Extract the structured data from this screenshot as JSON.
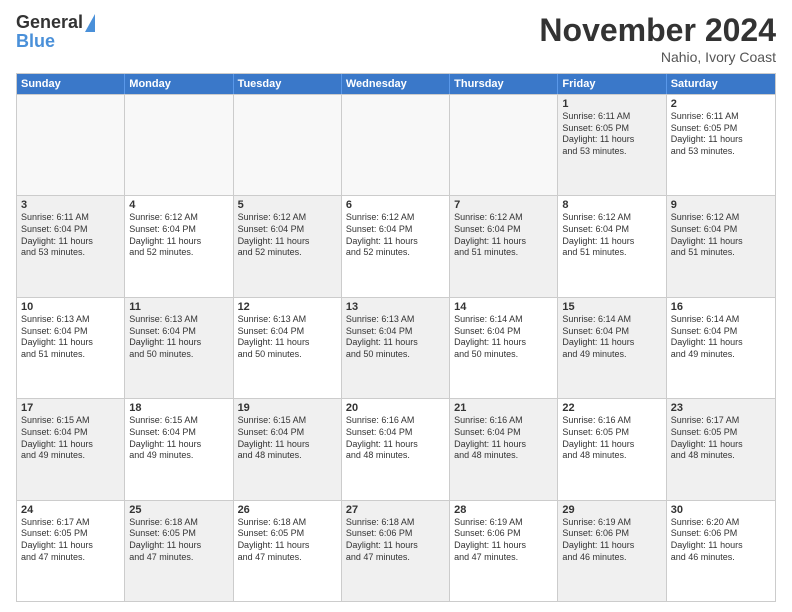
{
  "logo": {
    "general": "General",
    "blue": "Blue"
  },
  "title": "November 2024",
  "location": "Nahio, Ivory Coast",
  "days": [
    "Sunday",
    "Monday",
    "Tuesday",
    "Wednesday",
    "Thursday",
    "Friday",
    "Saturday"
  ],
  "rows": [
    [
      {
        "num": "",
        "lines": []
      },
      {
        "num": "",
        "lines": []
      },
      {
        "num": "",
        "lines": []
      },
      {
        "num": "",
        "lines": []
      },
      {
        "num": "",
        "lines": []
      },
      {
        "num": "1",
        "lines": [
          "Sunrise: 6:11 AM",
          "Sunset: 6:05 PM",
          "Daylight: 11 hours",
          "and 53 minutes."
        ]
      },
      {
        "num": "2",
        "lines": [
          "Sunrise: 6:11 AM",
          "Sunset: 6:05 PM",
          "Daylight: 11 hours",
          "and 53 minutes."
        ]
      }
    ],
    [
      {
        "num": "3",
        "lines": [
          "Sunrise: 6:11 AM",
          "Sunset: 6:04 PM",
          "Daylight: 11 hours",
          "and 53 minutes."
        ]
      },
      {
        "num": "4",
        "lines": [
          "Sunrise: 6:12 AM",
          "Sunset: 6:04 PM",
          "Daylight: 11 hours",
          "and 52 minutes."
        ]
      },
      {
        "num": "5",
        "lines": [
          "Sunrise: 6:12 AM",
          "Sunset: 6:04 PM",
          "Daylight: 11 hours",
          "and 52 minutes."
        ]
      },
      {
        "num": "6",
        "lines": [
          "Sunrise: 6:12 AM",
          "Sunset: 6:04 PM",
          "Daylight: 11 hours",
          "and 52 minutes."
        ]
      },
      {
        "num": "7",
        "lines": [
          "Sunrise: 6:12 AM",
          "Sunset: 6:04 PM",
          "Daylight: 11 hours",
          "and 51 minutes."
        ]
      },
      {
        "num": "8",
        "lines": [
          "Sunrise: 6:12 AM",
          "Sunset: 6:04 PM",
          "Daylight: 11 hours",
          "and 51 minutes."
        ]
      },
      {
        "num": "9",
        "lines": [
          "Sunrise: 6:12 AM",
          "Sunset: 6:04 PM",
          "Daylight: 11 hours",
          "and 51 minutes."
        ]
      }
    ],
    [
      {
        "num": "10",
        "lines": [
          "Sunrise: 6:13 AM",
          "Sunset: 6:04 PM",
          "Daylight: 11 hours",
          "and 51 minutes."
        ]
      },
      {
        "num": "11",
        "lines": [
          "Sunrise: 6:13 AM",
          "Sunset: 6:04 PM",
          "Daylight: 11 hours",
          "and 50 minutes."
        ]
      },
      {
        "num": "12",
        "lines": [
          "Sunrise: 6:13 AM",
          "Sunset: 6:04 PM",
          "Daylight: 11 hours",
          "and 50 minutes."
        ]
      },
      {
        "num": "13",
        "lines": [
          "Sunrise: 6:13 AM",
          "Sunset: 6:04 PM",
          "Daylight: 11 hours",
          "and 50 minutes."
        ]
      },
      {
        "num": "14",
        "lines": [
          "Sunrise: 6:14 AM",
          "Sunset: 6:04 PM",
          "Daylight: 11 hours",
          "and 50 minutes."
        ]
      },
      {
        "num": "15",
        "lines": [
          "Sunrise: 6:14 AM",
          "Sunset: 6:04 PM",
          "Daylight: 11 hours",
          "and 49 minutes."
        ]
      },
      {
        "num": "16",
        "lines": [
          "Sunrise: 6:14 AM",
          "Sunset: 6:04 PM",
          "Daylight: 11 hours",
          "and 49 minutes."
        ]
      }
    ],
    [
      {
        "num": "17",
        "lines": [
          "Sunrise: 6:15 AM",
          "Sunset: 6:04 PM",
          "Daylight: 11 hours",
          "and 49 minutes."
        ]
      },
      {
        "num": "18",
        "lines": [
          "Sunrise: 6:15 AM",
          "Sunset: 6:04 PM",
          "Daylight: 11 hours",
          "and 49 minutes."
        ]
      },
      {
        "num": "19",
        "lines": [
          "Sunrise: 6:15 AM",
          "Sunset: 6:04 PM",
          "Daylight: 11 hours",
          "and 48 minutes."
        ]
      },
      {
        "num": "20",
        "lines": [
          "Sunrise: 6:16 AM",
          "Sunset: 6:04 PM",
          "Daylight: 11 hours",
          "and 48 minutes."
        ]
      },
      {
        "num": "21",
        "lines": [
          "Sunrise: 6:16 AM",
          "Sunset: 6:04 PM",
          "Daylight: 11 hours",
          "and 48 minutes."
        ]
      },
      {
        "num": "22",
        "lines": [
          "Sunrise: 6:16 AM",
          "Sunset: 6:05 PM",
          "Daylight: 11 hours",
          "and 48 minutes."
        ]
      },
      {
        "num": "23",
        "lines": [
          "Sunrise: 6:17 AM",
          "Sunset: 6:05 PM",
          "Daylight: 11 hours",
          "and 48 minutes."
        ]
      }
    ],
    [
      {
        "num": "24",
        "lines": [
          "Sunrise: 6:17 AM",
          "Sunset: 6:05 PM",
          "Daylight: 11 hours",
          "and 47 minutes."
        ]
      },
      {
        "num": "25",
        "lines": [
          "Sunrise: 6:18 AM",
          "Sunset: 6:05 PM",
          "Daylight: 11 hours",
          "and 47 minutes."
        ]
      },
      {
        "num": "26",
        "lines": [
          "Sunrise: 6:18 AM",
          "Sunset: 6:05 PM",
          "Daylight: 11 hours",
          "and 47 minutes."
        ]
      },
      {
        "num": "27",
        "lines": [
          "Sunrise: 6:18 AM",
          "Sunset: 6:06 PM",
          "Daylight: 11 hours",
          "and 47 minutes."
        ]
      },
      {
        "num": "28",
        "lines": [
          "Sunrise: 6:19 AM",
          "Sunset: 6:06 PM",
          "Daylight: 11 hours",
          "and 47 minutes."
        ]
      },
      {
        "num": "29",
        "lines": [
          "Sunrise: 6:19 AM",
          "Sunset: 6:06 PM",
          "Daylight: 11 hours",
          "and 46 minutes."
        ]
      },
      {
        "num": "30",
        "lines": [
          "Sunrise: 6:20 AM",
          "Sunset: 6:06 PM",
          "Daylight: 11 hours",
          "and 46 minutes."
        ]
      }
    ]
  ]
}
